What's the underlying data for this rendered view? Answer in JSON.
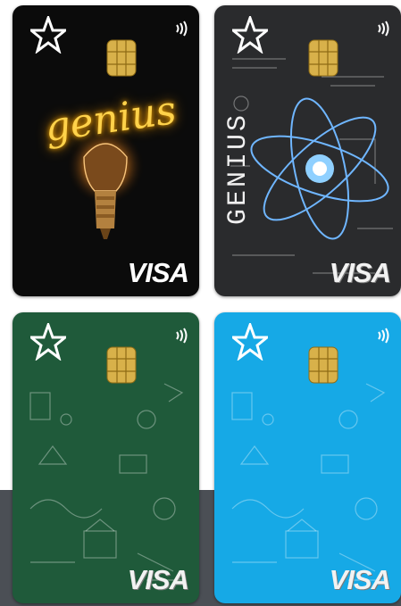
{
  "cards": [
    {
      "id": "genius-bulb",
      "theme": "black-lightbulb",
      "script_text": "genius",
      "network": "VISA",
      "colors": {
        "bg": "#0b0b0b",
        "glow": "#ffd24a"
      }
    },
    {
      "id": "genius-chalkboard",
      "theme": "chalkboard-atom",
      "vertical_text": "GENIUS",
      "network": "VISA",
      "colors": {
        "bg": "#2a2b2d",
        "atom": "#6fb6ff"
      }
    },
    {
      "id": "green-doodles",
      "theme": "green-school-doodles",
      "network": "VISA",
      "colors": {
        "bg": "#1f5a3a"
      }
    },
    {
      "id": "blue-doodles",
      "theme": "blue-school-doodles",
      "network": "VISA",
      "colors": {
        "bg": "#16a9e6"
      }
    }
  ],
  "icons": {
    "logo": "star-logo-icon",
    "contactless": "contactless-icon",
    "chip": "emv-chip-icon"
  }
}
